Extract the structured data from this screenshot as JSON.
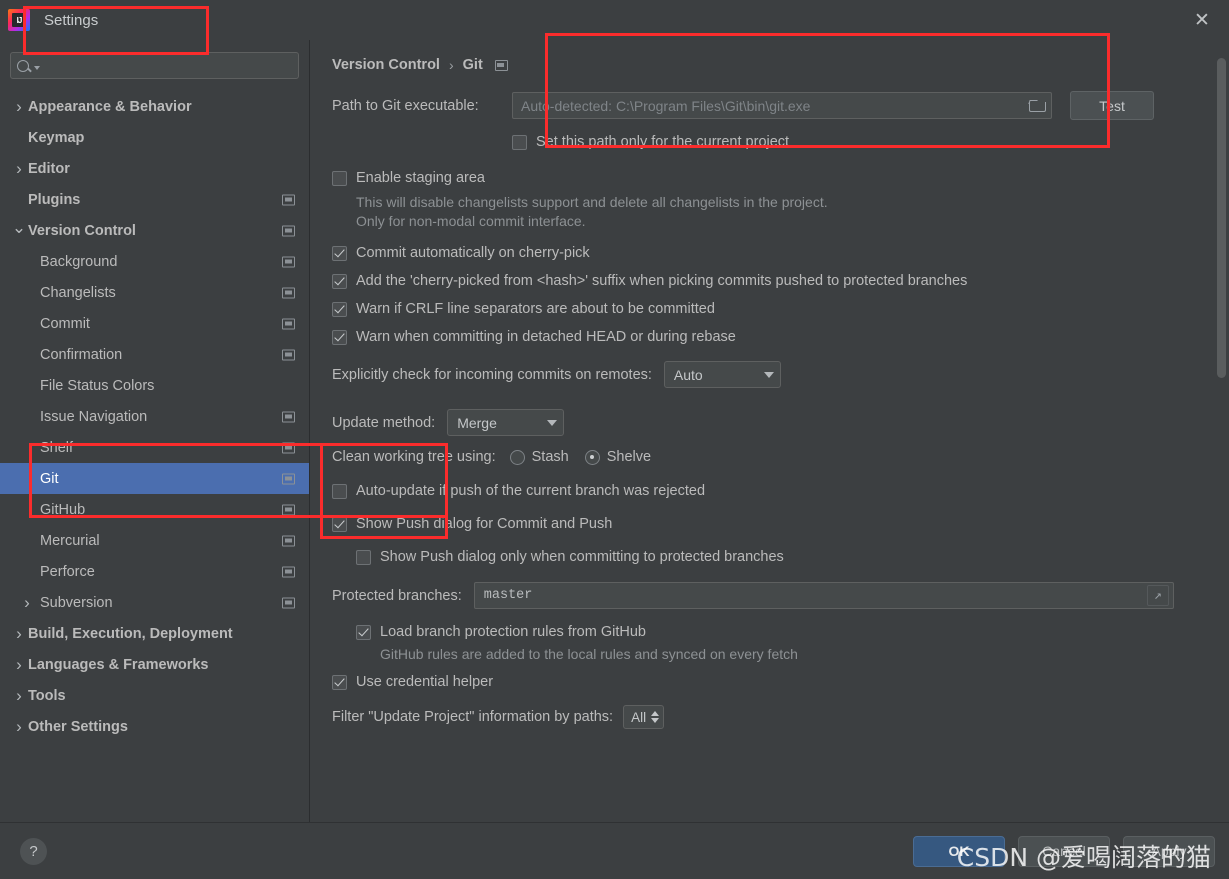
{
  "window": {
    "title": "Settings",
    "app_icon": "intellij-idea-icon",
    "close_label": "✕"
  },
  "search": {
    "value": "",
    "placeholder": "",
    "icon": "search-icon"
  },
  "sidebar": {
    "items": [
      {
        "label": "Appearance & Behavior",
        "level": 0,
        "arrow": "collapsed",
        "bold": true,
        "cfg": false,
        "selected": false
      },
      {
        "label": "Keymap",
        "level": 0,
        "arrow": "none",
        "bold": true,
        "cfg": false,
        "selected": false
      },
      {
        "label": "Editor",
        "level": 0,
        "arrow": "collapsed",
        "bold": true,
        "cfg": false,
        "selected": false
      },
      {
        "label": "Plugins",
        "level": 0,
        "arrow": "none",
        "bold": true,
        "cfg": true,
        "selected": false
      },
      {
        "label": "Version Control",
        "level": 0,
        "arrow": "expanded",
        "bold": true,
        "cfg": true,
        "selected": false
      },
      {
        "label": "Background",
        "level": 1,
        "arrow": "none",
        "bold": false,
        "cfg": true,
        "selected": false
      },
      {
        "label": "Changelists",
        "level": 1,
        "arrow": "none",
        "bold": false,
        "cfg": true,
        "selected": false
      },
      {
        "label": "Commit",
        "level": 1,
        "arrow": "none",
        "bold": false,
        "cfg": true,
        "selected": false
      },
      {
        "label": "Confirmation",
        "level": 1,
        "arrow": "none",
        "bold": false,
        "cfg": true,
        "selected": false
      },
      {
        "label": "File Status Colors",
        "level": 1,
        "arrow": "none",
        "bold": false,
        "cfg": false,
        "selected": false
      },
      {
        "label": "Issue Navigation",
        "level": 1,
        "arrow": "none",
        "bold": false,
        "cfg": true,
        "selected": false
      },
      {
        "label": "Shelf",
        "level": 1,
        "arrow": "none",
        "bold": false,
        "cfg": true,
        "selected": false
      },
      {
        "label": "Git",
        "level": 1,
        "arrow": "none",
        "bold": false,
        "cfg": true,
        "selected": true
      },
      {
        "label": "GitHub",
        "level": 1,
        "arrow": "none",
        "bold": false,
        "cfg": true,
        "selected": false
      },
      {
        "label": "Mercurial",
        "level": 1,
        "arrow": "none",
        "bold": false,
        "cfg": true,
        "selected": false
      },
      {
        "label": "Perforce",
        "level": 1,
        "arrow": "none",
        "bold": false,
        "cfg": true,
        "selected": false
      },
      {
        "label": "Subversion",
        "level": 1,
        "arrow": "collapsed",
        "bold": false,
        "cfg": true,
        "selected": false
      },
      {
        "label": "Build, Execution, Deployment",
        "level": 0,
        "arrow": "collapsed",
        "bold": true,
        "cfg": false,
        "selected": false
      },
      {
        "label": "Languages & Frameworks",
        "level": 0,
        "arrow": "collapsed",
        "bold": true,
        "cfg": false,
        "selected": false
      },
      {
        "label": "Tools",
        "level": 0,
        "arrow": "collapsed",
        "bold": true,
        "cfg": false,
        "selected": false
      },
      {
        "label": "Other Settings",
        "level": 0,
        "arrow": "collapsed",
        "bold": true,
        "cfg": false,
        "selected": false
      }
    ]
  },
  "main": {
    "breadcrumb": {
      "root": "Version Control",
      "separator": "›",
      "leaf": "Git"
    },
    "path_label": "Path to Git executable:",
    "path_value": "Auto-detected: C:\\Program Files\\Git\\bin\\git.exe",
    "test_button": "Test",
    "set_path_only_current_project": "Set this path only for the current project",
    "enable_staging_area": "Enable staging area",
    "enable_staging_desc": "This will disable changelists support and delete all changelists in the project. Only for non-modal commit interface.",
    "commit_auto_cherry_pick": "Commit automatically on cherry-pick",
    "add_cherry_picked_suffix": "Add the 'cherry-picked from <hash>' suffix when picking commits pushed to protected branches",
    "warn_crlf": "Warn if CRLF line separators are about to be committed",
    "warn_detached_head": "Warn when committing in detached HEAD or during rebase",
    "explicit_check_label": "Explicitly check for incoming commits on remotes:",
    "explicit_check_value": "Auto",
    "update_method_label": "Update method:",
    "update_method_value": "Merge",
    "clean_tree_label": "Clean working tree using:",
    "clean_tree_stash": "Stash",
    "clean_tree_shelve": "Shelve",
    "auto_update_rejected": "Auto-update if push of the current branch was rejected",
    "show_push_dialog": "Show Push dialog for Commit and Push",
    "show_push_dialog_protected": "Show Push dialog only when committing to protected branches",
    "protected_branches_label": "Protected branches:",
    "protected_branches_value": "master",
    "load_branch_rules": "Load branch protection rules from GitHub",
    "load_branch_rules_desc": "GitHub rules are added to the local rules and synced on every fetch",
    "use_credential_helper": "Use credential helper",
    "filter_label": "Filter \"Update Project\" information by paths:",
    "filter_value": "All"
  },
  "footer": {
    "help": "?",
    "ok": "OK",
    "cancel": "Cancel",
    "apply": "Apply"
  },
  "watermark": "CSDN @爱喝阔落的猫",
  "colors": {
    "background": "#3c3f41",
    "selection": "#4b6eaf",
    "primary_button": "#365880",
    "annotation": "#fb2c2c",
    "text": "#bbbbbb"
  }
}
